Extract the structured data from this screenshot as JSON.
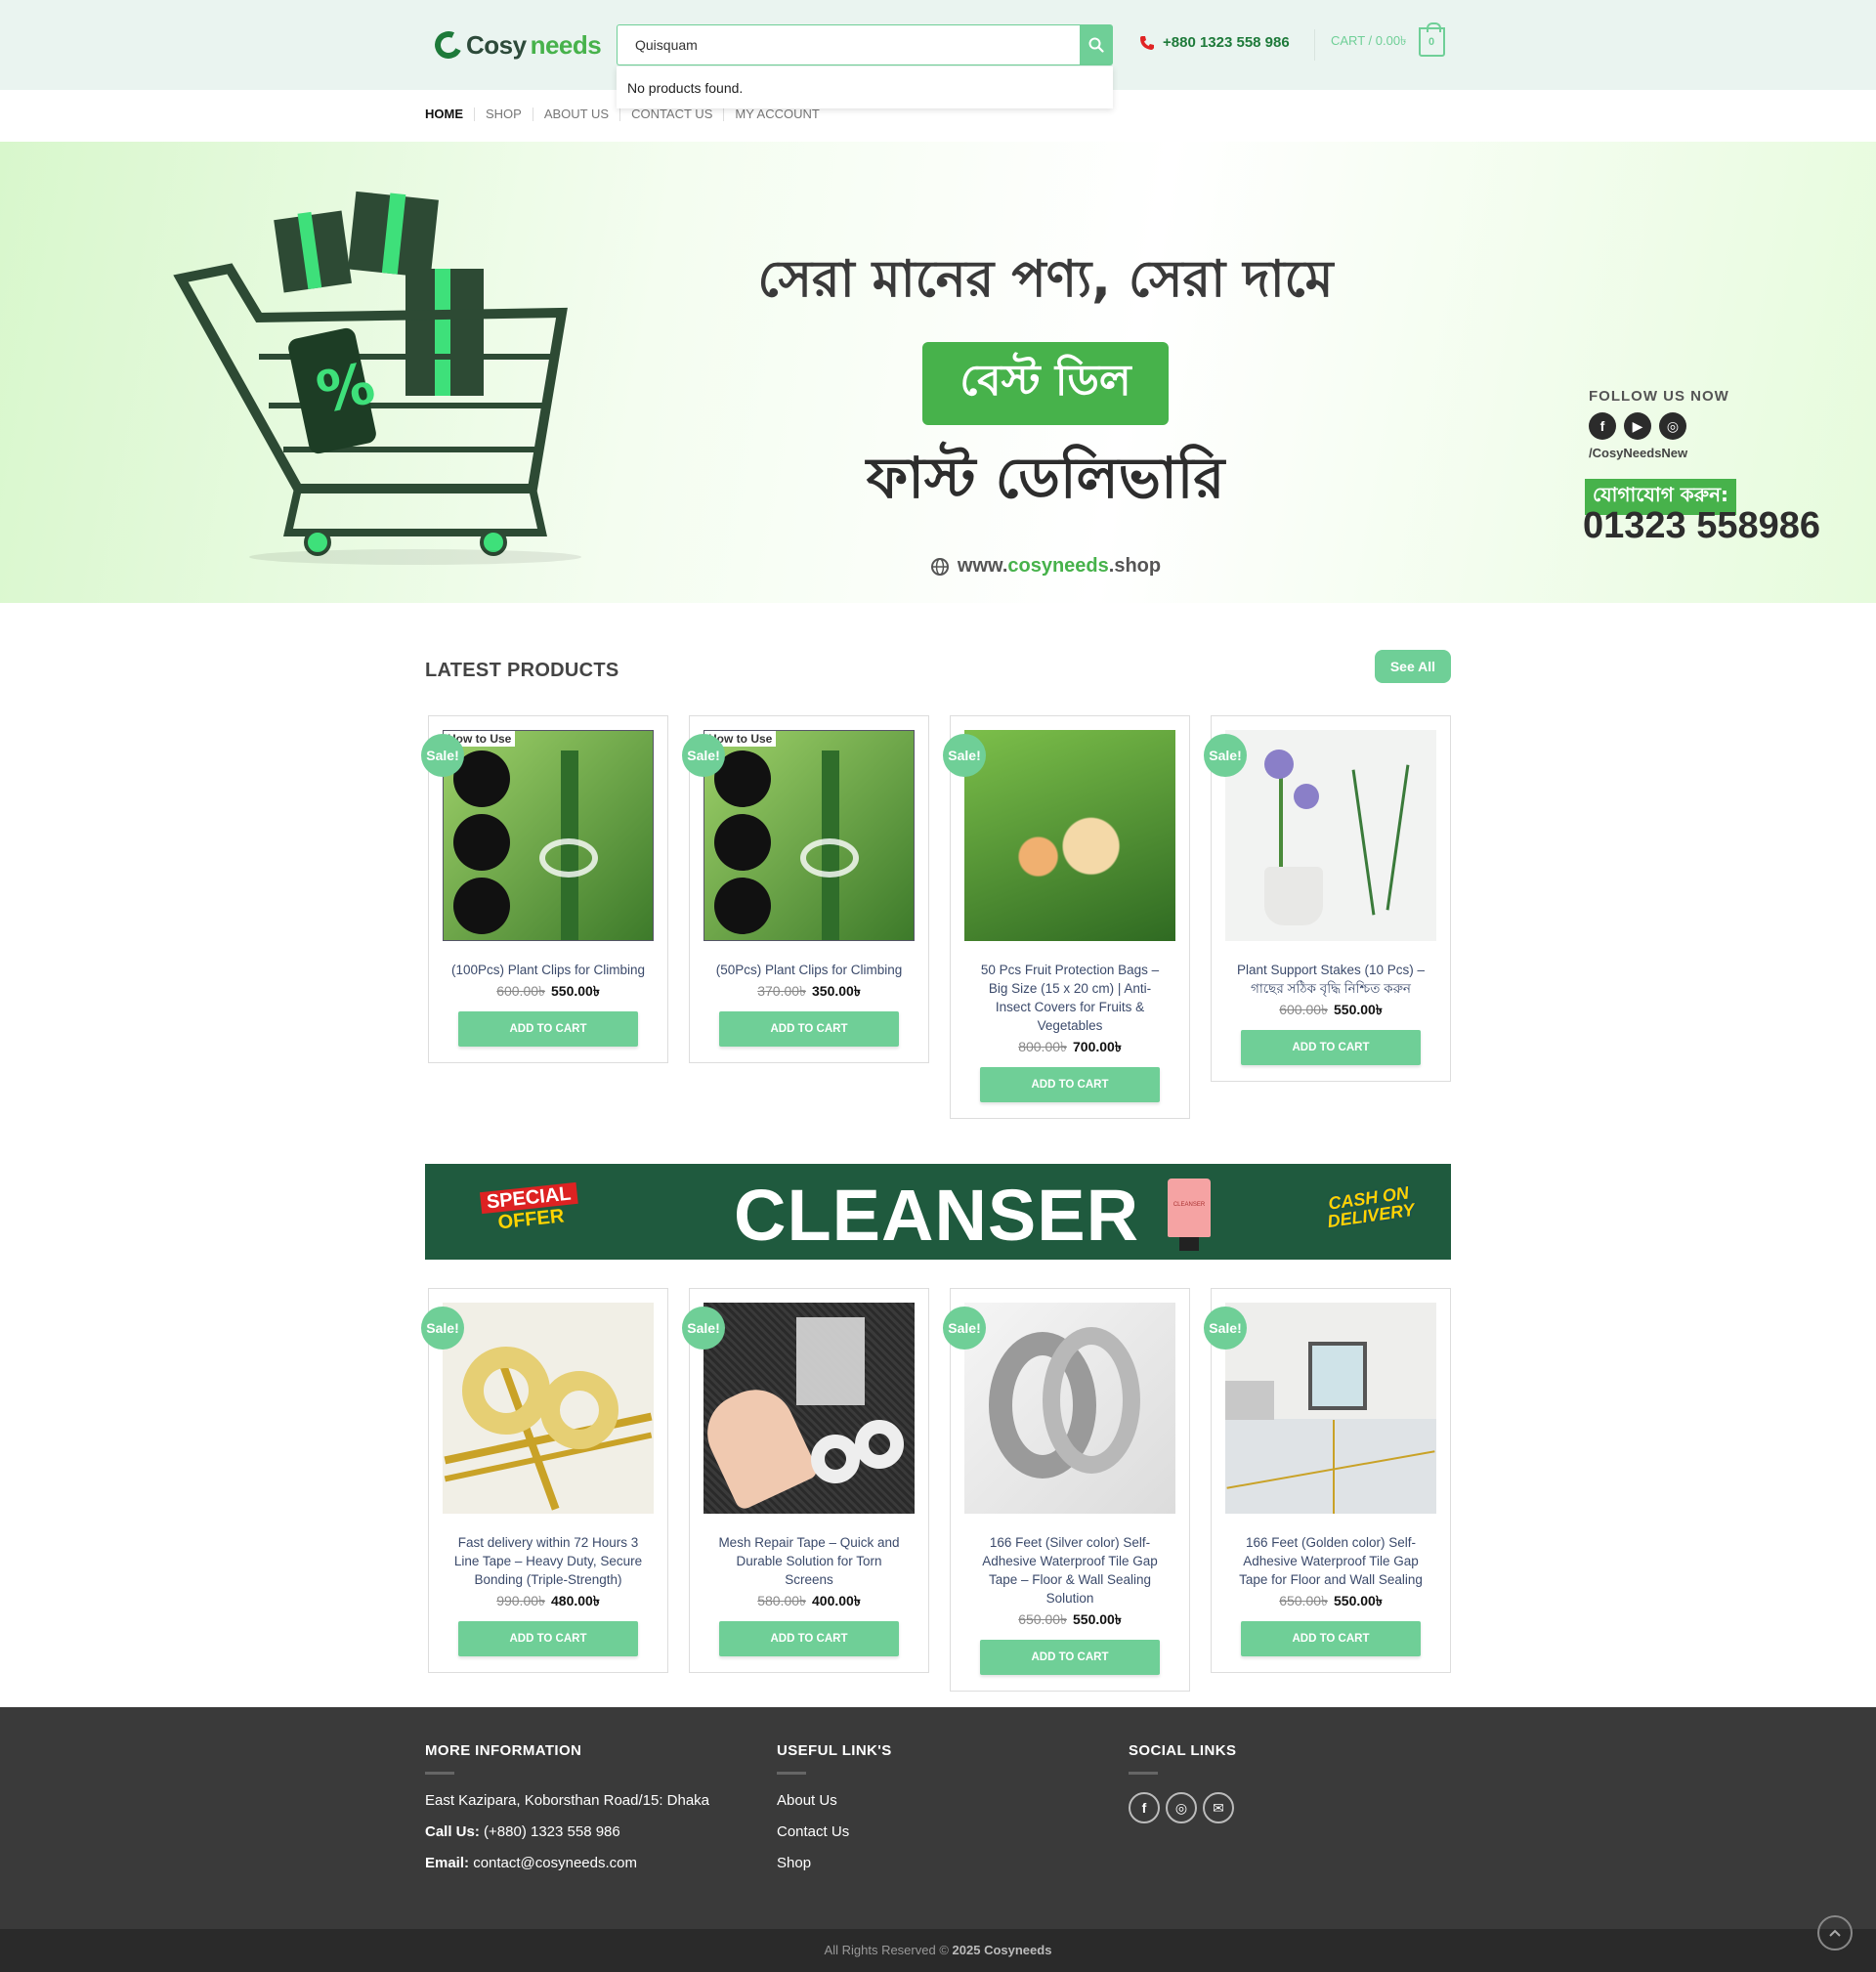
{
  "header": {
    "logo_a": "Cosy",
    "logo_b": "needs",
    "search_value": "Quisquam",
    "search_result": "No products found.",
    "phone": "+880 1323 558 986",
    "cart_label": "CART / 0.00৳",
    "cart_count": "0"
  },
  "nav": [
    "HOME",
    "SHOP",
    "ABOUT US",
    "CONTACT US",
    "MY ACCOUNT"
  ],
  "hero": {
    "line1": "সেরা মানের পণ্য, সেরা দামে",
    "badge": "বেস্ট ডিল",
    "line3": "ফাস্ট ডেলিভারি",
    "url_a": "www.",
    "url_b": "cosyneeds",
    "url_c": ".shop",
    "follow_label": "FOLLOW US NOW",
    "handle": "/CosyNeedsNew",
    "contact_label": "যোগাযোগ করুন:",
    "contact_number": "01323 558986"
  },
  "latest": {
    "title": "LATEST PRODUCTS",
    "see_all": "See All"
  },
  "sale_label": "Sale!",
  "add_to_cart": "ADD TO CART",
  "products_row1": [
    {
      "title": "(100Pcs) Plant Clips for Climbing",
      "old": "600.00৳",
      "new": "550.00৳",
      "img_text": "How to Use"
    },
    {
      "title": "(50Pcs) Plant Clips for Climbing",
      "old": "370.00৳",
      "new": "350.00৳",
      "img_text": "How to Use"
    },
    {
      "title": "50 Pcs Fruit Protection Bags – Big Size (15 x 20 cm) | Anti-Insect Covers for Fruits & Vegetables",
      "old": "800.00৳",
      "new": "700.00৳",
      "img_text": ""
    },
    {
      "title": "Plant Support Stakes (10 Pcs) – গাছের সঠিক বৃদ্ধি নিশ্চিত করুন",
      "old": "600.00৳",
      "new": "550.00৳",
      "img_text": ""
    }
  ],
  "cleanser": {
    "special_a": "SPECIAL",
    "special_b": "OFFER",
    "title": "CLEANSER",
    "tube_text": "CLEANSER",
    "cod_a": "CASH ON",
    "cod_b": "DELIVERY"
  },
  "products_row2": [
    {
      "title": "Fast delivery within 72 Hours 3 Line Tape – Heavy Duty, Secure Bonding (Triple-Strength)",
      "old": "990.00৳",
      "new": "480.00৳"
    },
    {
      "title": "Mesh Repair Tape – Quick and Durable Solution for Torn Screens",
      "old": "580.00৳",
      "new": "400.00৳"
    },
    {
      "title": "166 Feet (Silver color) Self-Adhesive Waterproof Tile Gap Tape – Floor & Wall Sealing Solution",
      "old": "650.00৳",
      "new": "550.00৳"
    },
    {
      "title": "166 Feet (Golden color) Self-Adhesive Waterproof Tile Gap Tape for Floor and Wall Sealing",
      "old": "650.00৳",
      "new": "550.00৳"
    }
  ],
  "footer": {
    "more_title": "MORE INFORMATION",
    "address": "East Kazipara, Koborsthan Road/15: Dhaka",
    "call_label": "Call Us:",
    "call_value": "(+880) 1323 558 986",
    "email_label": "Email:",
    "email_value": "contact@cosyneeds.com",
    "links_title": "USEFUL LINK'S",
    "links": [
      "About Us",
      "Contact Us",
      "Shop"
    ],
    "social_title": "SOCIAL LINKS",
    "copyright_a": "All Rights Reserved ©",
    "copyright_b": "2025 Cosyneeds"
  },
  "colors": {
    "accent": "#6fcf97",
    "brand_dark": "#1e7a3a",
    "footer_bg": "#3a3a3a"
  }
}
